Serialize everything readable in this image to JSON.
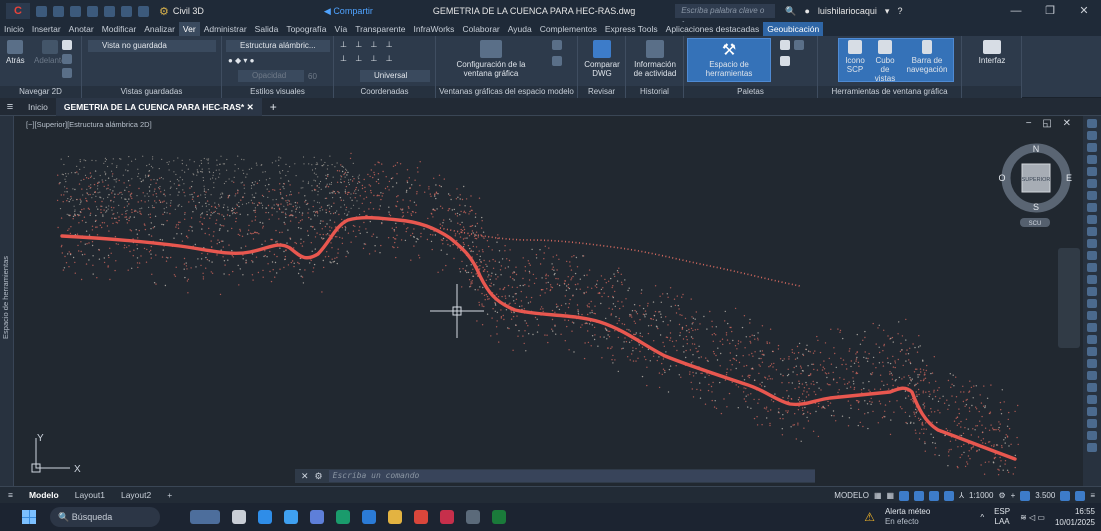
{
  "titlebar": {
    "logo": "C",
    "workspace": "Civil 3D",
    "share": "Compartir",
    "document": "GEMETRIA DE LA CUENCA PARA HEC-RAS.dwg",
    "search_placeholder": "Escriba palabra clave o frase",
    "user": "luishilariocaqui"
  },
  "ribbon_tabs": [
    "Inicio",
    "Insertar",
    "Anotar",
    "Modificar",
    "Analizar",
    "Ver",
    "Administrar",
    "Salida",
    "Topografía",
    "Vía",
    "Transparente",
    "InfraWorks",
    "Colaborar",
    "Ayuda",
    "Complementos",
    "Express Tools",
    "Aplicaciones destacadas",
    "Geoubicación"
  ],
  "ribbon": {
    "nav2d": {
      "back": "Atrás",
      "forward": "Adelante",
      "label": "Navegar 2D"
    },
    "views": {
      "unsaved": "Vista no guardada",
      "label": "Vistas guardadas"
    },
    "styles": {
      "wireframe": "Estructura alámbric...",
      "opacity": "Opacidad",
      "opacity_value": "60",
      "label": "Estilos visuales"
    },
    "coords": {
      "universal": "Universal",
      "label": "Coordenadas"
    },
    "viewports": {
      "config": "Configuración de la ventana gráfica",
      "label": "Ventanas gráficas del espacio modelo"
    },
    "compare": {
      "btn": "Comparar DWG",
      "label": "Revisar"
    },
    "history": {
      "btn": "Información de actividad",
      "label": "Historial"
    },
    "palettes": {
      "btn": "Espacio de herramientas",
      "label": "Paletas"
    },
    "vptools": {
      "ucs": "Icono SCP",
      "cube": "Cubo de vistas",
      "navbar": "Barra de navegación",
      "label": "Herramientas de ventana gráfica"
    },
    "interface": {
      "btn": "Interfaz"
    }
  },
  "doc_tabs": {
    "home": "Inicio",
    "active": "GEMETRIA DE LA CUENCA PARA HEC-RAS*"
  },
  "viewport": {
    "label": "[−][Superior][Estructura alámbrica 2D]",
    "sidebar": "Espacio de herramientas",
    "cube_face": "SUPERIOR",
    "compass": {
      "n": "N",
      "s": "S",
      "e": "E",
      "o": "O"
    },
    "ucs_label": "SCU",
    "axis_x": "X",
    "axis_y": "Y"
  },
  "command": {
    "placeholder": "Escriba un comando"
  },
  "status": {
    "layouts": [
      "Modelo",
      "Layout1",
      "Layout2"
    ],
    "mode": "MODELO",
    "scale": "1:1000",
    "value": "3.500"
  },
  "taskbar": {
    "search": "Búsqueda",
    "alert_title": "Alerta méteo",
    "alert_sub": "En efecto",
    "lang": "ESP",
    "lang_sub": "LAA",
    "time": "16:55",
    "date": "10/01/2025"
  },
  "colors": {
    "river": "#e8574f",
    "dots": "#d86a5f",
    "accent": "#2f66a6"
  }
}
